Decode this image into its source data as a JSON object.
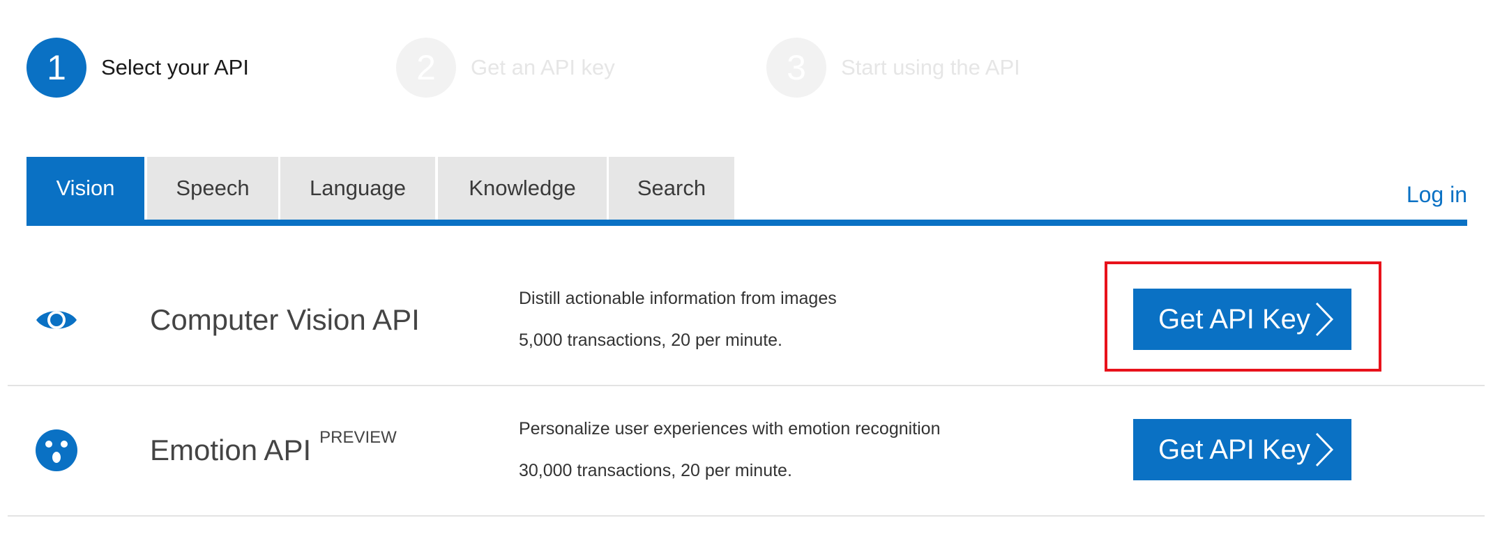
{
  "steps": [
    {
      "number": "1",
      "label": "Select your API",
      "state": "active"
    },
    {
      "number": "2",
      "label": "Get an API key",
      "state": "inactive"
    },
    {
      "number": "3",
      "label": "Start using the API",
      "state": "inactive"
    }
  ],
  "tabs": [
    {
      "label": "Vision",
      "selected": true
    },
    {
      "label": "Speech",
      "selected": false
    },
    {
      "label": "Language",
      "selected": false
    },
    {
      "label": "Knowledge",
      "selected": false
    },
    {
      "label": "Search",
      "selected": false
    }
  ],
  "login_label": "Log in",
  "apis": [
    {
      "name": "Computer Vision API",
      "tag": "",
      "icon": "eye-icon",
      "description": "Distill actionable information from images",
      "quota": "5,000 transactions, 20 per minute.",
      "button_label": "Get API Key",
      "highlighted": true
    },
    {
      "name": "Emotion API",
      "tag": "PREVIEW",
      "icon": "surprised-face-icon",
      "description": "Personalize user experiences with emotion recognition",
      "quota": "30,000 transactions, 20 per minute.",
      "button_label": "Get API Key",
      "highlighted": false
    }
  ],
  "colors": {
    "accent": "#0a71c4",
    "tab_inactive_bg": "#e6e6e6",
    "highlight": "#e8121b"
  }
}
